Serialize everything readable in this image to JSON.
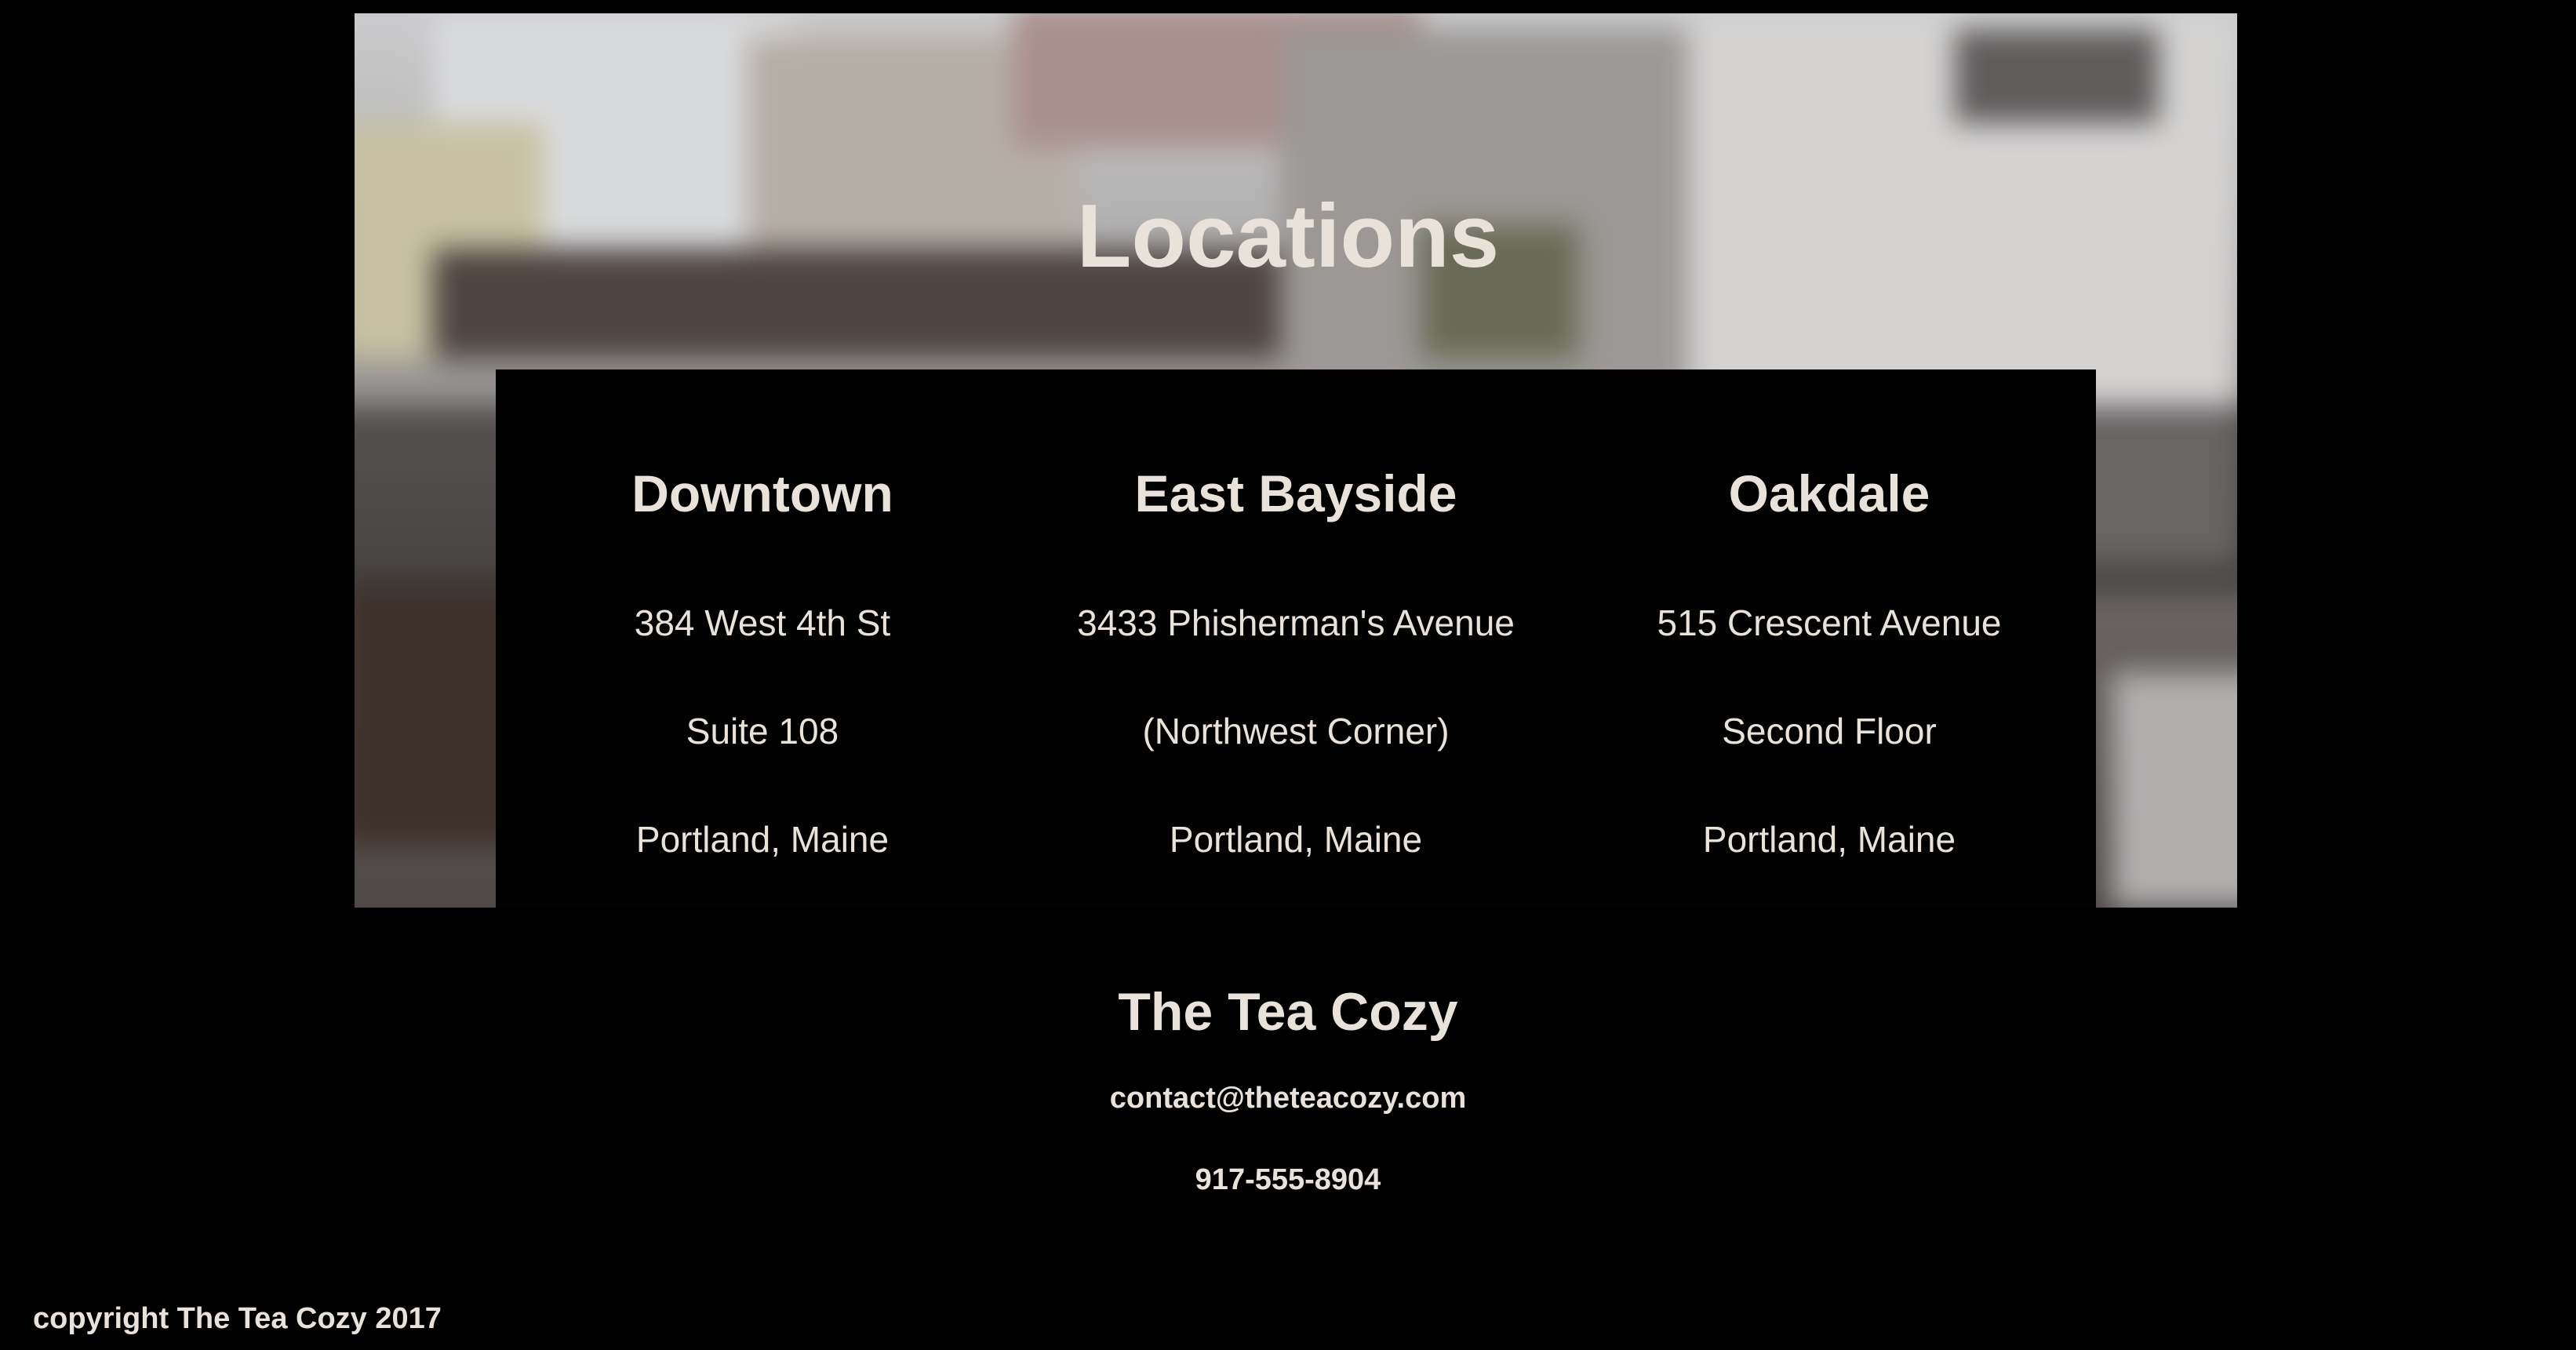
{
  "hero": {
    "title": "Locations"
  },
  "locations": [
    {
      "name": "Downtown",
      "address": [
        "384 West 4th St",
        "Suite 108",
        "Portland, Maine"
      ]
    },
    {
      "name": "East Bayside",
      "address": [
        "3433 Phisherman's Avenue",
        "(Northwest Corner)",
        "Portland, Maine"
      ]
    },
    {
      "name": "Oakdale",
      "address": [
        "515 Crescent Avenue",
        "Second Floor",
        "Portland, Maine"
      ]
    }
  ],
  "footer": {
    "business_name": "The Tea Cozy",
    "email": "contact@theteacozy.com",
    "phone": "917-555-8904",
    "copyright": "copyright The Tea Cozy 2017"
  },
  "colors": {
    "background": "#000000",
    "text": "#e8e2db",
    "panel": "#020202"
  }
}
